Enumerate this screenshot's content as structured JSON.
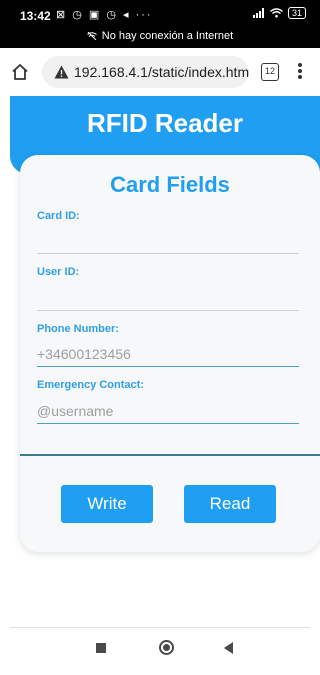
{
  "status_bar": {
    "time": "13:42",
    "notification_icons": "⊠ ◷ ▣ ◷ ◂ ···",
    "signal_icon": "signal-icon",
    "wifi_icon": "wifi-icon",
    "battery_level": "31",
    "network_message": "No hay conexión a Internet"
  },
  "browser": {
    "url": "192.168.4.1/static/index.htm",
    "tab_count": "12",
    "icons": [
      "home-icon",
      "warning-icon",
      "tabs-icon",
      "menu-icon"
    ]
  },
  "page": {
    "title": "RFID Reader",
    "accent_color": "#1f9ef2"
  },
  "card": {
    "title": "Card Fields",
    "fields": [
      {
        "label": "Card ID:",
        "value": "",
        "placeholder": ""
      },
      {
        "label": "User ID:",
        "value": "",
        "placeholder": ""
      },
      {
        "label": "Phone Number:",
        "value": "",
        "placeholder": "+34600123456"
      },
      {
        "label": "Emergency Contact:",
        "value": "",
        "placeholder": "@username"
      }
    ],
    "write_label": "Write",
    "read_label": "Read"
  },
  "nav_bar": {
    "icons": [
      "recent-apps-icon",
      "home-circle-icon",
      "back-icon"
    ]
  }
}
